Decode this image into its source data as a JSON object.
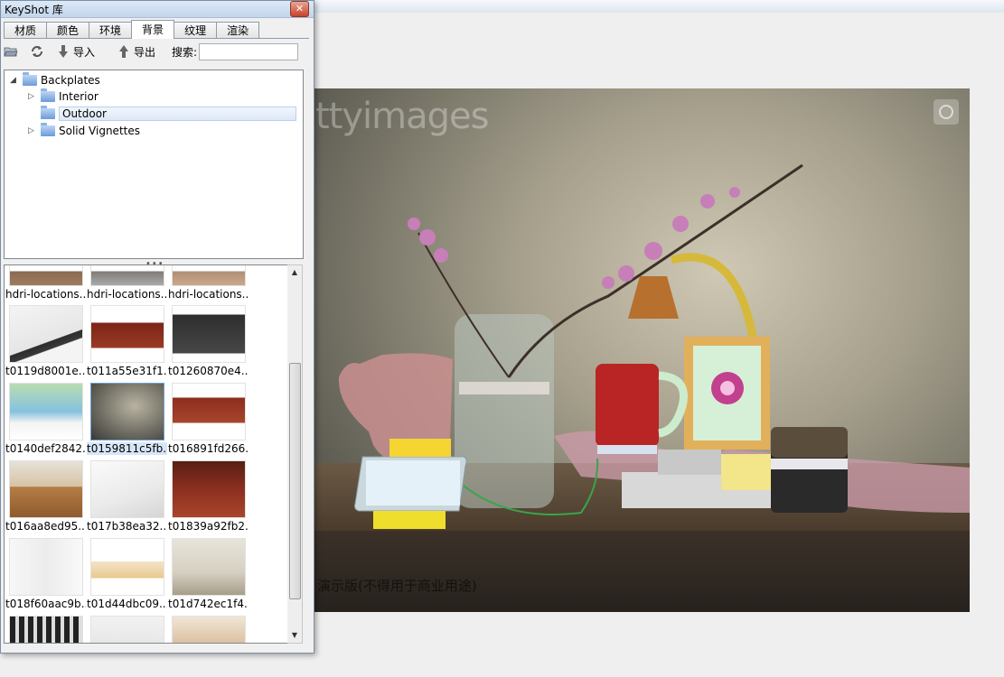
{
  "library": {
    "title": "KeyShot 库",
    "tabs": [
      "材质",
      "颜色",
      "环境",
      "背景",
      "纹理",
      "渲染"
    ],
    "active_tab": "背景",
    "toolbar": {
      "import_label": "导入",
      "export_label": "导出",
      "search_label": "搜索:",
      "search_value": ""
    },
    "tree": {
      "root": "Backplates",
      "children": [
        "Interior",
        "Outdoor",
        "Solid Vignettes"
      ],
      "selected": "Outdoor"
    },
    "thumbnails": [
      "hdri-locations...",
      "hdri-locations...",
      "hdri-locations...",
      "t0119d8001e...",
      "t011a55e31f1...",
      "t01260870e4...",
      "t0140def2842...",
      "t0159811c5fb...",
      "t016891fd266...",
      "t016aa8ed95...",
      "t017b38ea32...",
      "t01839a92fb2...",
      "t018f60aac9b...",
      "t01d44dbc09...",
      "t01d742ec1f4..."
    ],
    "selected_thumbnail": "t0159811c5fb..."
  },
  "render": {
    "watermark": "ttyimages",
    "footer": "演示版(不得用于商业用途)"
  },
  "colors": {
    "accent_select": "#d7e6f7",
    "close_button": "#c7432b"
  }
}
